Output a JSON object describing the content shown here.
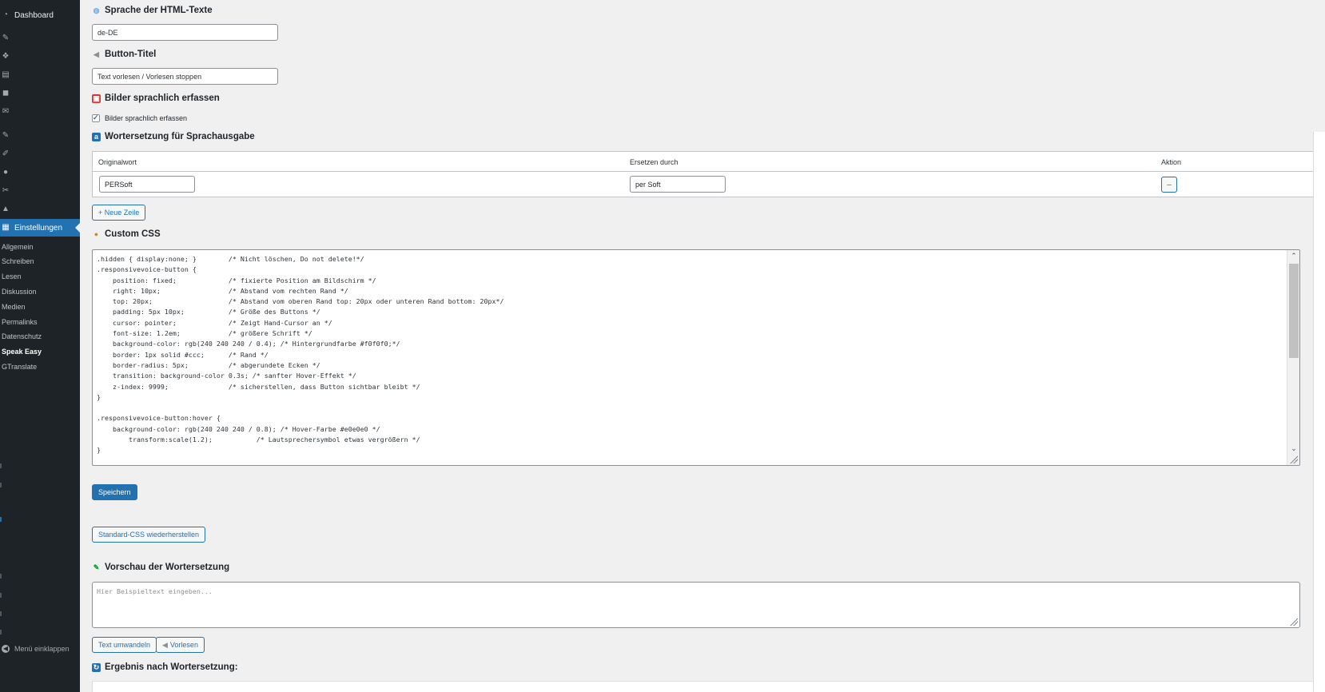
{
  "sidebar": {
    "dashboard": "Dashboard",
    "active": "Einstellungen",
    "submenu": [
      "Allgemein",
      "Schreiben",
      "Lesen",
      "Diskussion",
      "Medien",
      "Permalinks",
      "Datenschutz",
      "Speak Easy",
      "GTranslate"
    ],
    "current_sub": "Speak Easy",
    "collapse": "Menü einklappen"
  },
  "lang": {
    "heading": "Sprache der HTML-Texte",
    "value": "de-DE"
  },
  "button_title": {
    "heading": "Button-Titel",
    "value": "Text vorlesen / Vorlesen stoppen"
  },
  "images": {
    "heading": "Bilder sprachlich erfassen",
    "checkbox_label": "Bilder sprachlich erfassen",
    "checked": true
  },
  "replace": {
    "heading": "Wortersetzung für Sprachausgabe",
    "columns": [
      "Originalwort",
      "Ersetzen durch",
      "Aktion"
    ],
    "rows": [
      {
        "original": "PERSoft",
        "replacement": "per Soft",
        "action": "–"
      }
    ],
    "add_row": "+ Neue Zeile"
  },
  "css": {
    "heading": "Custom CSS",
    "code": ".hidden { display:none; }        /* Nicht löschen, Do not delete!*/\n.responsivevoice-button {\n    position: fixed;             /* fixierte Position am Bildschirm */\n    right: 10px;                 /* Abstand vom rechten Rand */\n    top: 20px;                   /* Abstand vom oberen Rand top: 20px oder unteren Rand bottom: 20px*/\n    padding: 5px 10px;           /* Größe des Buttons */\n    cursor: pointer;             /* Zeigt Hand-Cursor an */\n    font-size: 1.2em;            /* größere Schrift */\n    background-color: rgb(240 240 240 / 0.4); /* Hintergrundfarbe #f0f0f0;*/\n    border: 1px solid #ccc;      /* Rand */\n    border-radius: 5px;          /* abgerundete Ecken */\n    transition: background-color 0.3s; /* sanfter Hover-Effekt */\n    z-index: 9999;               /* sicherstellen, dass Button sichtbar bleibt */\n}\n\n.responsivevoice-button:hover {\n    background-color: rgb(240 240 240 / 0.8); /* Hover-Farbe #e0e0e0 */\n        transform:scale(1.2);           /* Lautsprechersymbol etwas vergrößern */\n}"
  },
  "buttons": {
    "save": "Speichern",
    "restore": "Standard-CSS wiederherstellen",
    "convert": "Text umwandeln",
    "read": "Vorlesen"
  },
  "preview": {
    "heading": "Vorschau der Wortersetzung",
    "placeholder": "Hier Beispieltext eingeben..."
  },
  "result": {
    "heading": "Ergebnis nach Wortersetzung:"
  },
  "colors": {
    "accent": "#2271b1",
    "sidebar": "#1d2327",
    "background": "#f0f0f1"
  }
}
